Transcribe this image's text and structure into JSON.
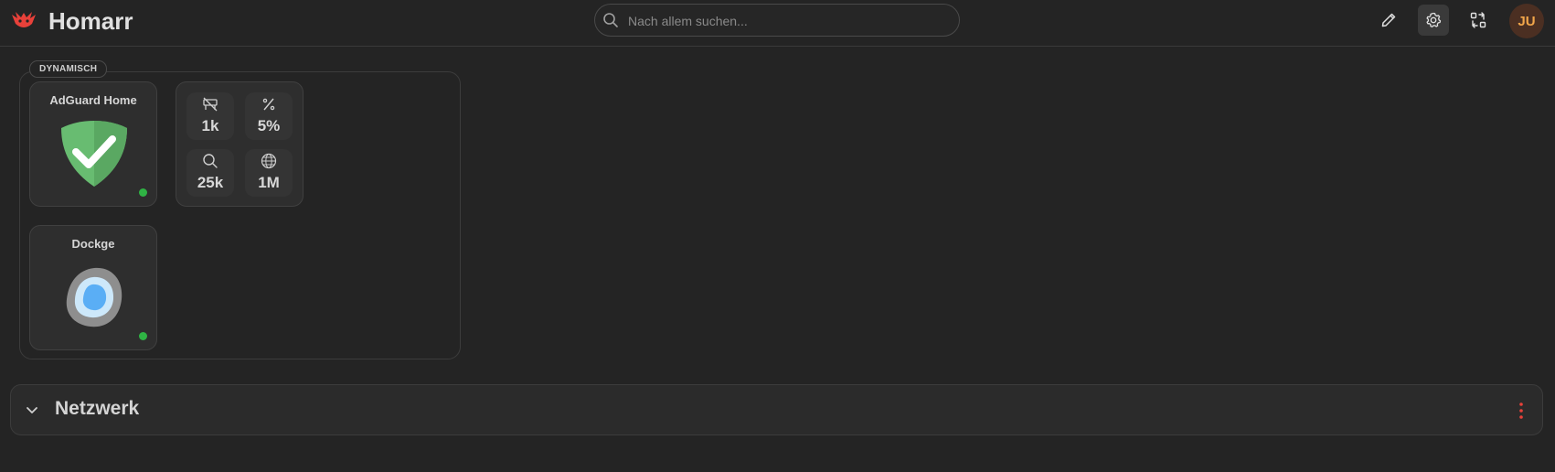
{
  "header": {
    "app_title": "Homarr",
    "logo_icon": "homarr-logo",
    "search": {
      "placeholder": "Nach allem suchen...",
      "value": ""
    },
    "buttons": [
      {
        "icon": "pencil-icon",
        "active": false
      },
      {
        "icon": "gear-icon",
        "active": true
      },
      {
        "icon": "arrows-exchange-icon",
        "active": false
      }
    ],
    "avatar_initials": "JU"
  },
  "dynamic_section": {
    "label": "DYNAMISCH",
    "apps": [
      {
        "name": "AdGuard Home",
        "icon": "adguard-shield-icon",
        "status": "online"
      },
      {
        "name": "Dockge",
        "icon": "dockge-icon",
        "status": "online"
      }
    ],
    "stats": [
      {
        "icon": "blocked-queries-icon",
        "value": "1k"
      },
      {
        "icon": "percent-icon",
        "value": "5%"
      },
      {
        "icon": "search-icon",
        "value": "25k"
      },
      {
        "icon": "www-icon",
        "value": "1M"
      }
    ]
  },
  "network_section": {
    "title": "Netzwerk",
    "collapsed": true
  },
  "colors": {
    "background": "#242424",
    "status_online": "#2fb344",
    "accent_red": "#e8413a",
    "avatar_text": "#f2a64a",
    "adguard_green": "#68bc71"
  }
}
